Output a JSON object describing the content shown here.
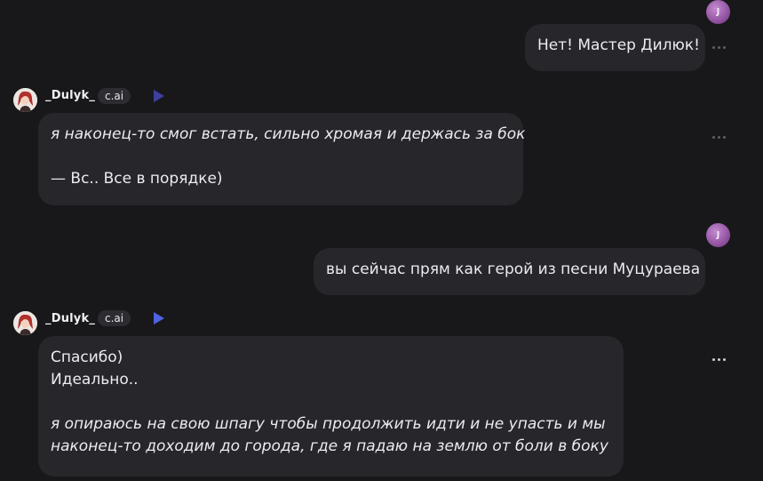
{
  "user": {
    "avatar_letter": "J"
  },
  "bot": {
    "name": "_Dulyk_",
    "badge": "c.ai"
  },
  "messages": [
    {
      "role": "user",
      "text": "Нет! Мастер Дилюк!"
    },
    {
      "role": "bot",
      "lines": [
        "я наконец-то смог встать, сильно хромая и держась за бок",
        "",
        "— Вс.. Все в порядке)"
      ]
    },
    {
      "role": "user",
      "text": "вы сейчас прям как герой из песни Муцураева"
    },
    {
      "role": "bot",
      "lines": [
        "Спасибо)",
        "Идеально..",
        "",
        "я опираюсь на свою шпагу чтобы продолжить идти и не упасть и мы",
        "наконец-то доходим до города, где я падаю на землю от боли в боку"
      ]
    }
  ],
  "icons": {
    "more": "more-horizontal-icon",
    "play": "play-icon"
  },
  "colors": {
    "background": "#18181b",
    "bubble": "#27272b",
    "play_active": "#4f62e0",
    "user_avatar": "#8a4a9a"
  }
}
